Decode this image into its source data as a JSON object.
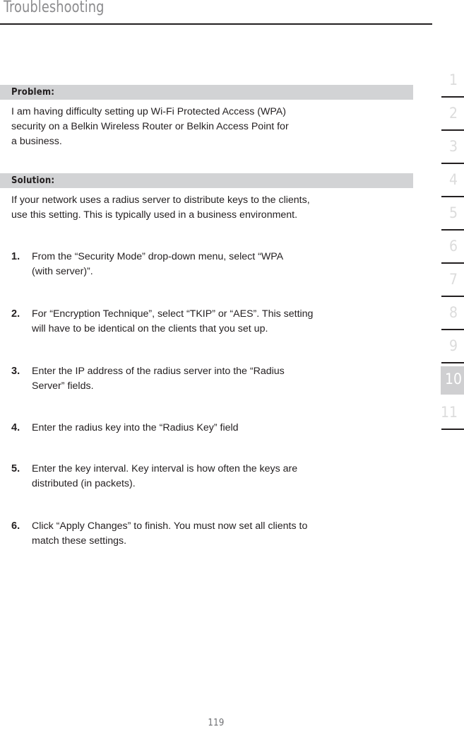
{
  "header": {
    "title": "Troubleshooting"
  },
  "sections": [
    {
      "bar_label": "Problem:",
      "body": "I am having difficulty setting up Wi-Fi Protected Access (WPA)\nsecurity on a Belkin Wireless Router or Belkin Access Point for\na business."
    },
    {
      "bar_label": "Solution:",
      "body": "If your network uses a radius server to distribute keys to the clients,\nuse this setting. This is typically used in a business environment."
    }
  ],
  "steps": [
    {
      "number": "1.",
      "text": "From the “Security Mode” drop-down menu, select “WPA\n(with server)”."
    },
    {
      "number": "2.",
      "text": "For “Encryption Technique”, select “TKIP” or “AES”. This setting\nwill have to be identical on the clients that you set up."
    },
    {
      "number": "3.",
      "text": "Enter the IP address of the radius server into the “Radius\nServer” fields."
    },
    {
      "number": "4.",
      "text": "Enter the radius key into the “Radius Key” field"
    },
    {
      "number": "5.",
      "text": "Enter the key interval. Key interval is how often the keys are\ndistributed (in packets)."
    },
    {
      "number": "6.",
      "text": "Click “Apply Changes” to finish. You must now set all clients to\nmatch these settings."
    }
  ],
  "section_rail": {
    "active_index": 9,
    "items": [
      {
        "label": "1"
      },
      {
        "label": "2"
      },
      {
        "label": "3"
      },
      {
        "label": "4"
      },
      {
        "label": "5"
      },
      {
        "label": "6"
      },
      {
        "label": "7"
      },
      {
        "label": "8"
      },
      {
        "label": "9"
      },
      {
        "label": "10"
      },
      {
        "label": "11"
      }
    ]
  },
  "footer": {
    "page_number": "119"
  },
  "colors": {
    "rule": "#231f20",
    "section_bar_bg": "#d2d3d5",
    "title_gray": "#8c8c8e",
    "rail_number_gray": "#dcdcdc",
    "rail_active_bg": "#cfcfd1",
    "rail_active_text": "#ffffff",
    "body_text": "#231f20",
    "folio_gray": "#6d6e71"
  }
}
